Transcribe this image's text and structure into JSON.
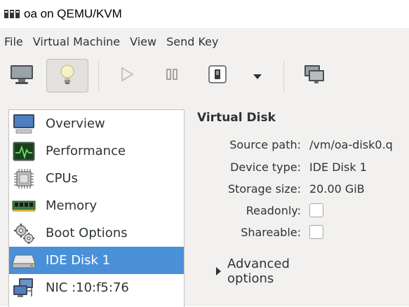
{
  "window": {
    "title": "oa on QEMU/KVM",
    "icon": "virt-manager-icon"
  },
  "menu": [
    "File",
    "Virtual Machine",
    "View",
    "Send Key"
  ],
  "toolbar": {
    "buttons": [
      {
        "name": "console-icon",
        "active": false
      },
      {
        "name": "lightbulb-icon",
        "active": true
      },
      {
        "name": "play-icon",
        "enabled": false
      },
      {
        "name": "pause-icon",
        "enabled": false
      },
      {
        "name": "shutdown-icon",
        "enabled": true
      },
      {
        "name": "chevron-down-icon",
        "enabled": true
      },
      {
        "name": "fullscreen-icon",
        "enabled": true
      }
    ]
  },
  "sidebar": {
    "items": [
      {
        "label": "Overview",
        "icon": "monitor-icon",
        "selected": false
      },
      {
        "label": "Performance",
        "icon": "performance-graph-icon",
        "selected": false
      },
      {
        "label": "CPUs",
        "icon": "cpu-chip-icon",
        "selected": false
      },
      {
        "label": "Memory",
        "icon": "memory-stick-icon",
        "selected": false
      },
      {
        "label": "Boot Options",
        "icon": "gears-icon",
        "selected": false
      },
      {
        "label": "IDE Disk 1",
        "icon": "hard-disk-icon",
        "selected": true
      },
      {
        "label": "NIC :10:f5:76",
        "icon": "network-icon",
        "selected": false
      }
    ]
  },
  "details": {
    "title": "Virtual Disk",
    "source_path_label": "Source path:",
    "source_path_value": "/vm/oa-disk0.q",
    "device_type_label": "Device type:",
    "device_type_value": "IDE Disk 1",
    "storage_size_label": "Storage size:",
    "storage_size_value": "20.00 GiB",
    "readonly_label": "Readonly:",
    "readonly_checked": false,
    "shareable_label": "Shareable:",
    "shareable_checked": false,
    "advanced_label": "Advanced options"
  },
  "colors": {
    "selection": "#4a90d9",
    "background": "#f2f1f0"
  }
}
